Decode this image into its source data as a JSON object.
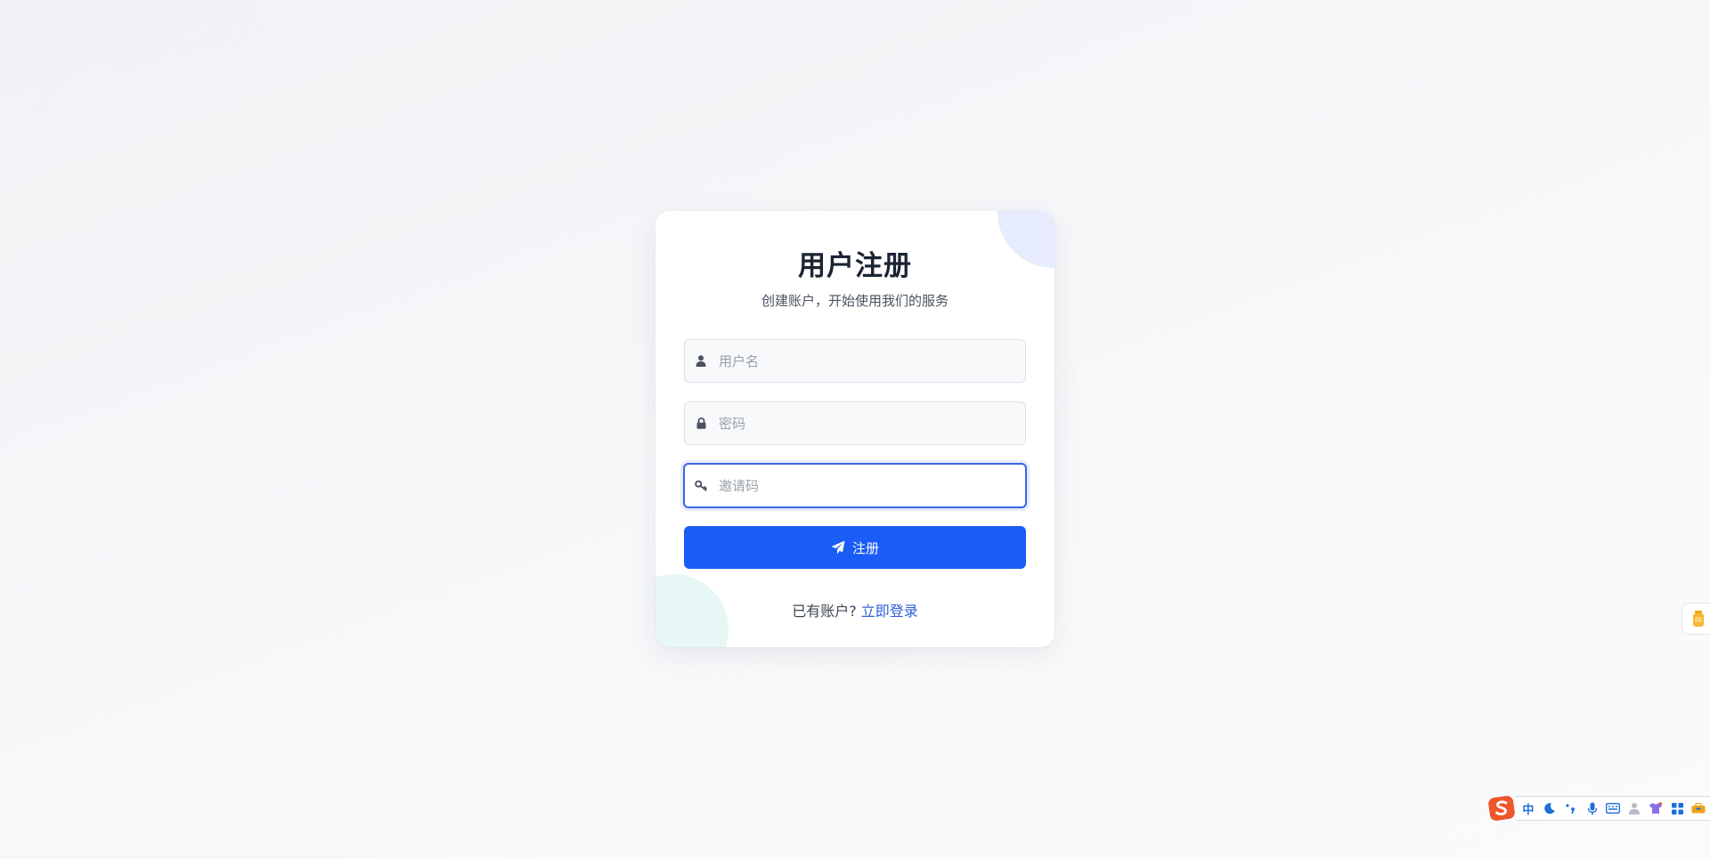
{
  "register": {
    "title": "用户注册",
    "subtitle": "创建账户，开始使用我们的服务",
    "username_placeholder": "用户名",
    "password_placeholder": "密码",
    "invite_placeholder": "邀请码",
    "submit_label": "注册",
    "footer_prefix": "已有账户?",
    "login_link": "立即登录"
  },
  "ime": {
    "mode_label": "中",
    "icons": [
      "moon-icon",
      "punctuation-icon",
      "microphone-icon",
      "keyboard-icon",
      "user-icon",
      "skin-icon",
      "apps-grid-icon",
      "toolbox-icon"
    ]
  },
  "colors": {
    "primary": "#1a5cf5",
    "focus_border": "#3b66e8",
    "link": "#2c5fd6",
    "ime_logo": "#f0562b"
  }
}
